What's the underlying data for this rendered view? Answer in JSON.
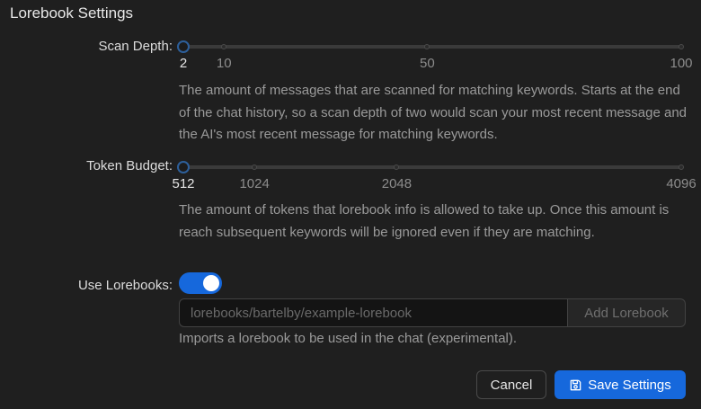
{
  "title": "Lorebook Settings",
  "scan_depth": {
    "label": "Scan Depth:",
    "value": 2,
    "min": 2,
    "max": 100,
    "marks": [
      "2",
      "10",
      "50",
      "100"
    ],
    "mark_values": [
      2,
      10,
      50,
      100
    ],
    "help": "The amount of messages that are scanned for matching keywords. Starts at the end of the chat history, so a scan depth of two would scan your most recent message and the AI's most recent message for matching keywords."
  },
  "token_budget": {
    "label": "Token Budget:",
    "value": 512,
    "min": 512,
    "max": 4096,
    "marks": [
      "512",
      "1024",
      "2048",
      "4096"
    ],
    "mark_values": [
      512,
      1024,
      2048,
      4096
    ],
    "help": "The amount of tokens that lorebook info is allowed to take up. Once this amount is reach subsequent keywords will be ignored even if they are matching."
  },
  "use_lorebooks": {
    "label": "Use Lorebooks:",
    "enabled": true
  },
  "lorebook_input": {
    "placeholder": "lorebooks/bartelby/example-lorebook",
    "value": "",
    "add_label": "Add Lorebook",
    "help": "Imports a lorebook to be used in the chat (experimental)."
  },
  "buttons": {
    "cancel": "Cancel",
    "save": "Save Settings"
  },
  "colors": {
    "accent": "#1668dc",
    "background": "#1f1f1f",
    "handle_border": "#2d5f9a"
  },
  "icons": {
    "save": "save-icon"
  }
}
